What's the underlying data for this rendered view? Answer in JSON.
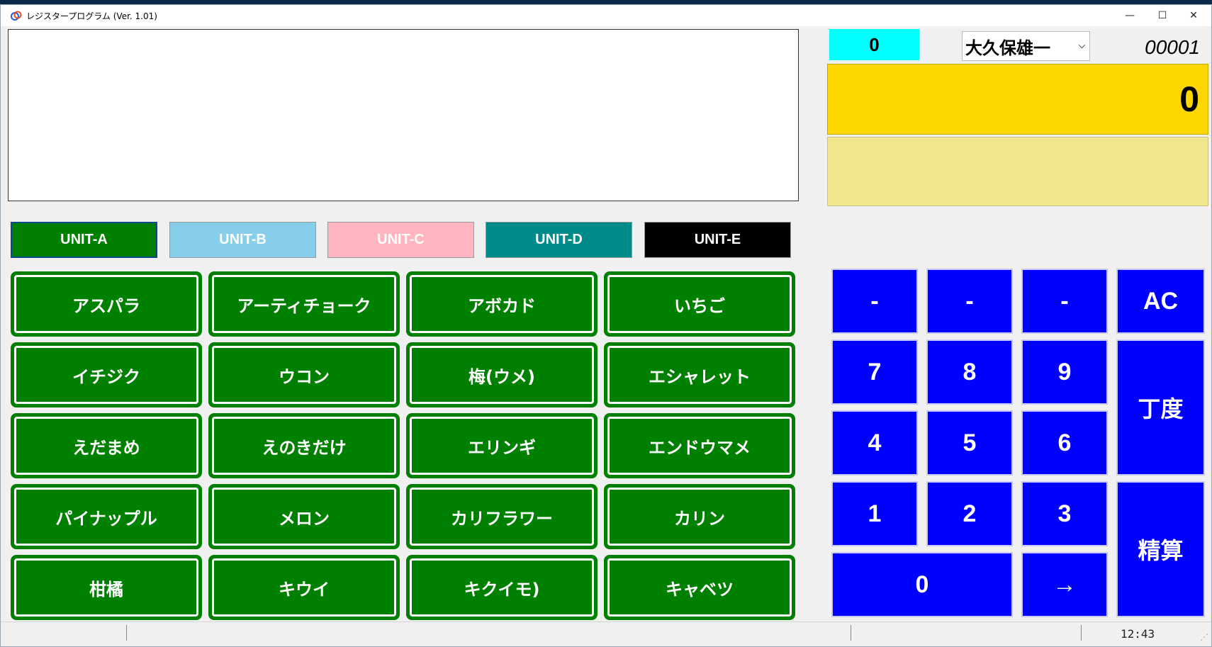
{
  "window": {
    "title": "レジスタープログラム (Ver. 1.01)"
  },
  "window_controls": {
    "minimize": "—",
    "maximize": "☐",
    "close": "✕"
  },
  "header": {
    "counter": "0",
    "staff_selected": "大久保雄一",
    "receipt_number": "00001",
    "total": "0"
  },
  "unit_tabs": [
    {
      "label": "UNIT-A",
      "bg": "#008000",
      "fg": "#ffffff"
    },
    {
      "label": "UNIT-B",
      "bg": "#87ceeb",
      "fg": "#ffffff"
    },
    {
      "label": "UNIT-C",
      "bg": "#ffb6c1",
      "fg": "#ffffff"
    },
    {
      "label": "UNIT-D",
      "bg": "#008b8b",
      "fg": "#ffffff"
    },
    {
      "label": "UNIT-E",
      "bg": "#000000",
      "fg": "#ffffff"
    }
  ],
  "products": [
    "アスパラ",
    "アーティチョーク",
    "アボカド",
    "いちご",
    "イチジク",
    "ウコン",
    "梅(ウメ)",
    "エシャレット",
    "えだまめ",
    "えのきだけ",
    "エリンギ",
    "エンドウマメ",
    "パイナップル",
    "メロン",
    "カリフラワー",
    "カリン",
    "柑橘",
    "キウイ",
    "キクイモ)",
    "キャベツ"
  ],
  "keypad": {
    "dash1": "-",
    "dash2": "-",
    "dash3": "-",
    "ac": "AC",
    "k7": "7",
    "k8": "8",
    "k9": "9",
    "k4": "4",
    "k5": "5",
    "k6": "6",
    "k1": "1",
    "k2": "2",
    "k3": "3",
    "k0": "0",
    "arrow": "→",
    "exact": "丁度",
    "settle": "精算"
  },
  "status": {
    "time": "12:43"
  },
  "colors": {
    "product_green": "#008000",
    "key_blue": "#0000ff",
    "counter_cyan": "#00ffff",
    "total_yellow": "#ffd700",
    "subpanel_khaki": "#f0e68c"
  }
}
